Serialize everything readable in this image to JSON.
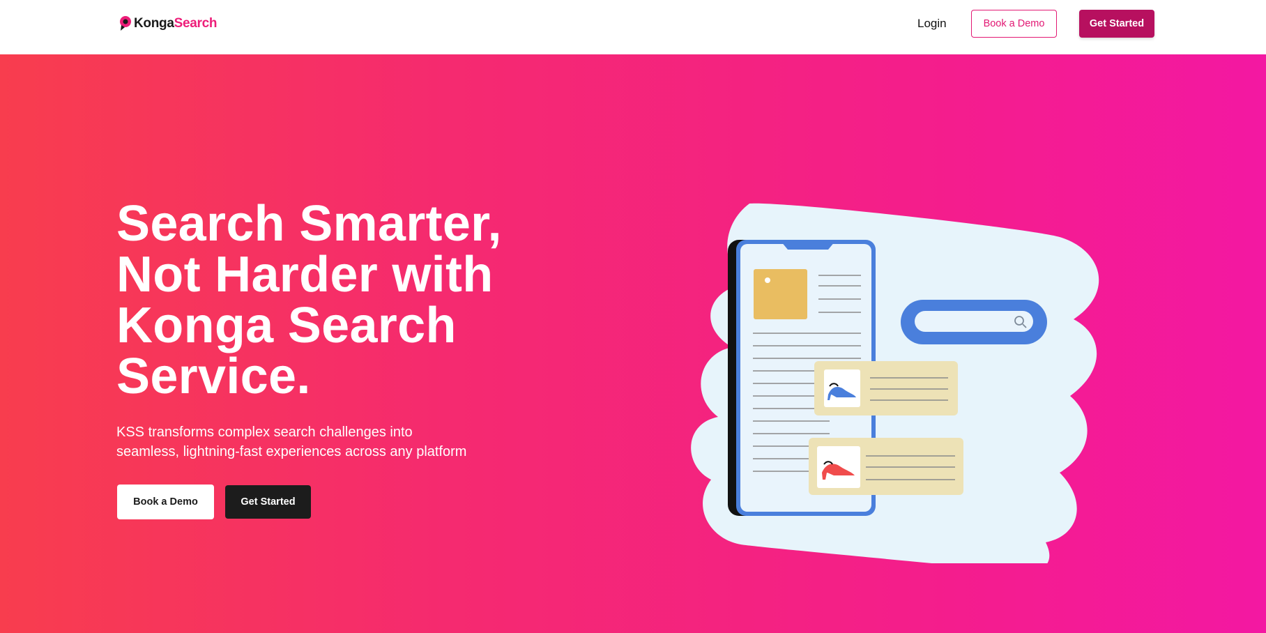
{
  "header": {
    "logo": {
      "part1": "Konga",
      "part2": "Search"
    },
    "nav": {
      "login_label": "Login",
      "book_demo_label": "Book a Demo",
      "get_started_label": "Get Started"
    }
  },
  "hero": {
    "title_lines": [
      "Search Smarter,",
      "Not Harder with",
      "Konga Search",
      "Service."
    ],
    "subtitle_lines": [
      "KSS transforms complex search challenges into",
      "seamless, lightning-fast experiences across any platform"
    ],
    "book_demo_label": "Book a Demo",
    "get_started_label": "Get Started"
  },
  "colors": {
    "brand_pink": "#ed1e79",
    "nav_cta": "#b7105f",
    "hero_gradient_start": "#f83d4e",
    "hero_gradient_end": "#f318a2",
    "dark_button": "#1c1c1c"
  },
  "icons": [
    "logo-pin-icon",
    "search-icon",
    "blue-heel-shoe-icon",
    "red-heel-shoe-icon"
  ]
}
